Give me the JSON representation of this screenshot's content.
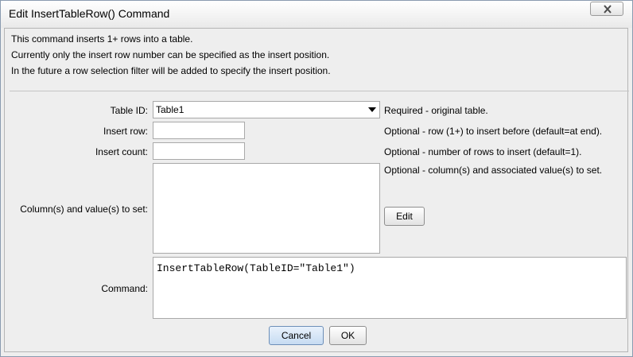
{
  "window": {
    "title": "Edit InsertTableRow() Command"
  },
  "description": {
    "lines": [
      "This command inserts 1+ rows into a table.",
      "Currently only the insert row number can be specified as the insert position.",
      "In the future a row selection filter will be added to specify the insert position."
    ]
  },
  "form": {
    "table_id": {
      "label": "Table ID:",
      "value": "Table1",
      "hint": "Required - original table."
    },
    "insert_row": {
      "label": "Insert row:",
      "value": "",
      "hint": "Optional - row (1+) to insert before (default=at end)."
    },
    "insert_count": {
      "label": "Insert count:",
      "value": "",
      "hint": "Optional - number of rows to insert (default=1)."
    },
    "column_values": {
      "label": "Column(s) and value(s) to set:",
      "value": "",
      "hint": "Optional - column(s) and associated value(s) to set.",
      "edit_label": "Edit"
    },
    "command": {
      "label": "Command:",
      "value": "InsertTableRow(TableID=\"Table1\")"
    }
  },
  "buttons": {
    "cancel": "Cancel",
    "ok": "OK"
  },
  "icons": {
    "close": "close-icon",
    "dropdown": "dropdown-arrow-icon"
  },
  "colors": {
    "default_button": "#c6dbf2",
    "window_bg": "#eeeeee"
  }
}
